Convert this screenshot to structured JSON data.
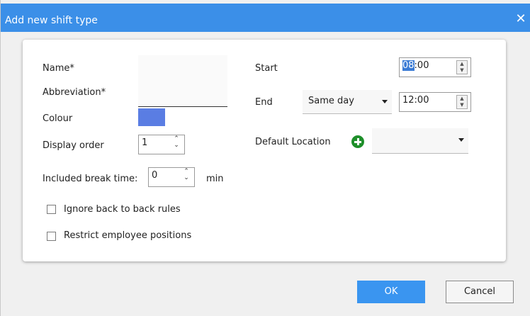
{
  "dialog": {
    "title": "Add new shift type",
    "close_icon": "close-icon"
  },
  "form": {
    "name_label": "Name*",
    "abbreviation_label": "Abbreviation*",
    "colour_label": "Colour",
    "colour_value": "#5a7de3",
    "display_order_label": "Display order",
    "display_order_value": "1",
    "break_label": "Included break time:",
    "break_value": "0",
    "break_unit": "min",
    "ignore_b2b_label": "Ignore back to back rules",
    "restrict_positions_label": "Restrict employee positions",
    "start_label": "Start",
    "start_hour": "08",
    "start_rest": ":00",
    "end_label": "End",
    "end_day": "Same day",
    "end_time": "12:00",
    "default_location_label": "Default Location",
    "default_location_value": ""
  },
  "buttons": {
    "ok": "OK",
    "cancel": "Cancel"
  },
  "colors": {
    "titlebar": "#3b8fe8",
    "ok_button": "#3a95f0"
  }
}
